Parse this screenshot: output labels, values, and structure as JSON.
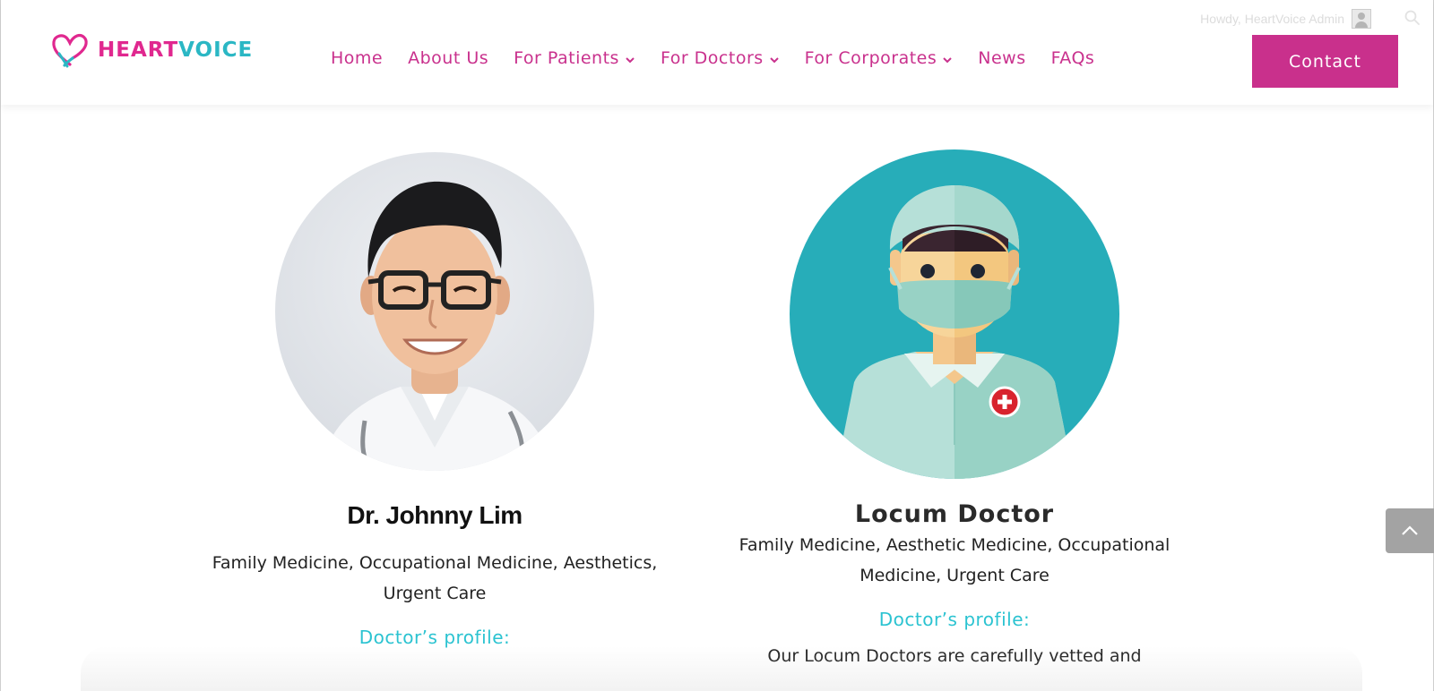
{
  "admin_bar": {
    "greeting": "Howdy, HeartVoice Admin",
    "avatar_icon": "user-avatar-icon",
    "search_icon": "search-icon"
  },
  "header": {
    "logo": {
      "part1": "HEART",
      "part2": "VOICE",
      "icon": "heart-logo-icon"
    },
    "nav": [
      {
        "label": "Home",
        "dropdown": false
      },
      {
        "label": "About Us",
        "dropdown": false
      },
      {
        "label": "For Patients",
        "dropdown": true
      },
      {
        "label": "For Doctors",
        "dropdown": true
      },
      {
        "label": "For Corporates",
        "dropdown": true
      },
      {
        "label": "News",
        "dropdown": false
      },
      {
        "label": "FAQs",
        "dropdown": false
      }
    ],
    "contact_label": "Contact"
  },
  "doctors": [
    {
      "name": "Dr. Johnny Lim",
      "specialties": "Family Medicine, Occupational Medicine, Aesthetics, Urgent Care",
      "profile_label": "Doctor’s profile:"
    },
    {
      "name": "Locum Doctor",
      "specialties": "Family Medicine, Aesthetic Medicine, Occupational Medicine, Urgent Care",
      "profile_label": "Doctor’s profile:",
      "profile_text": "Our Locum Doctors are carefully vetted and"
    }
  ],
  "scroll_top_icon": "chevron-up-icon",
  "colors": {
    "brand_pink": "#c9308c",
    "brand_teal": "#2bb7c4",
    "profile_teal": "#2bc3d1",
    "avatar_bg": "#27adb9"
  }
}
